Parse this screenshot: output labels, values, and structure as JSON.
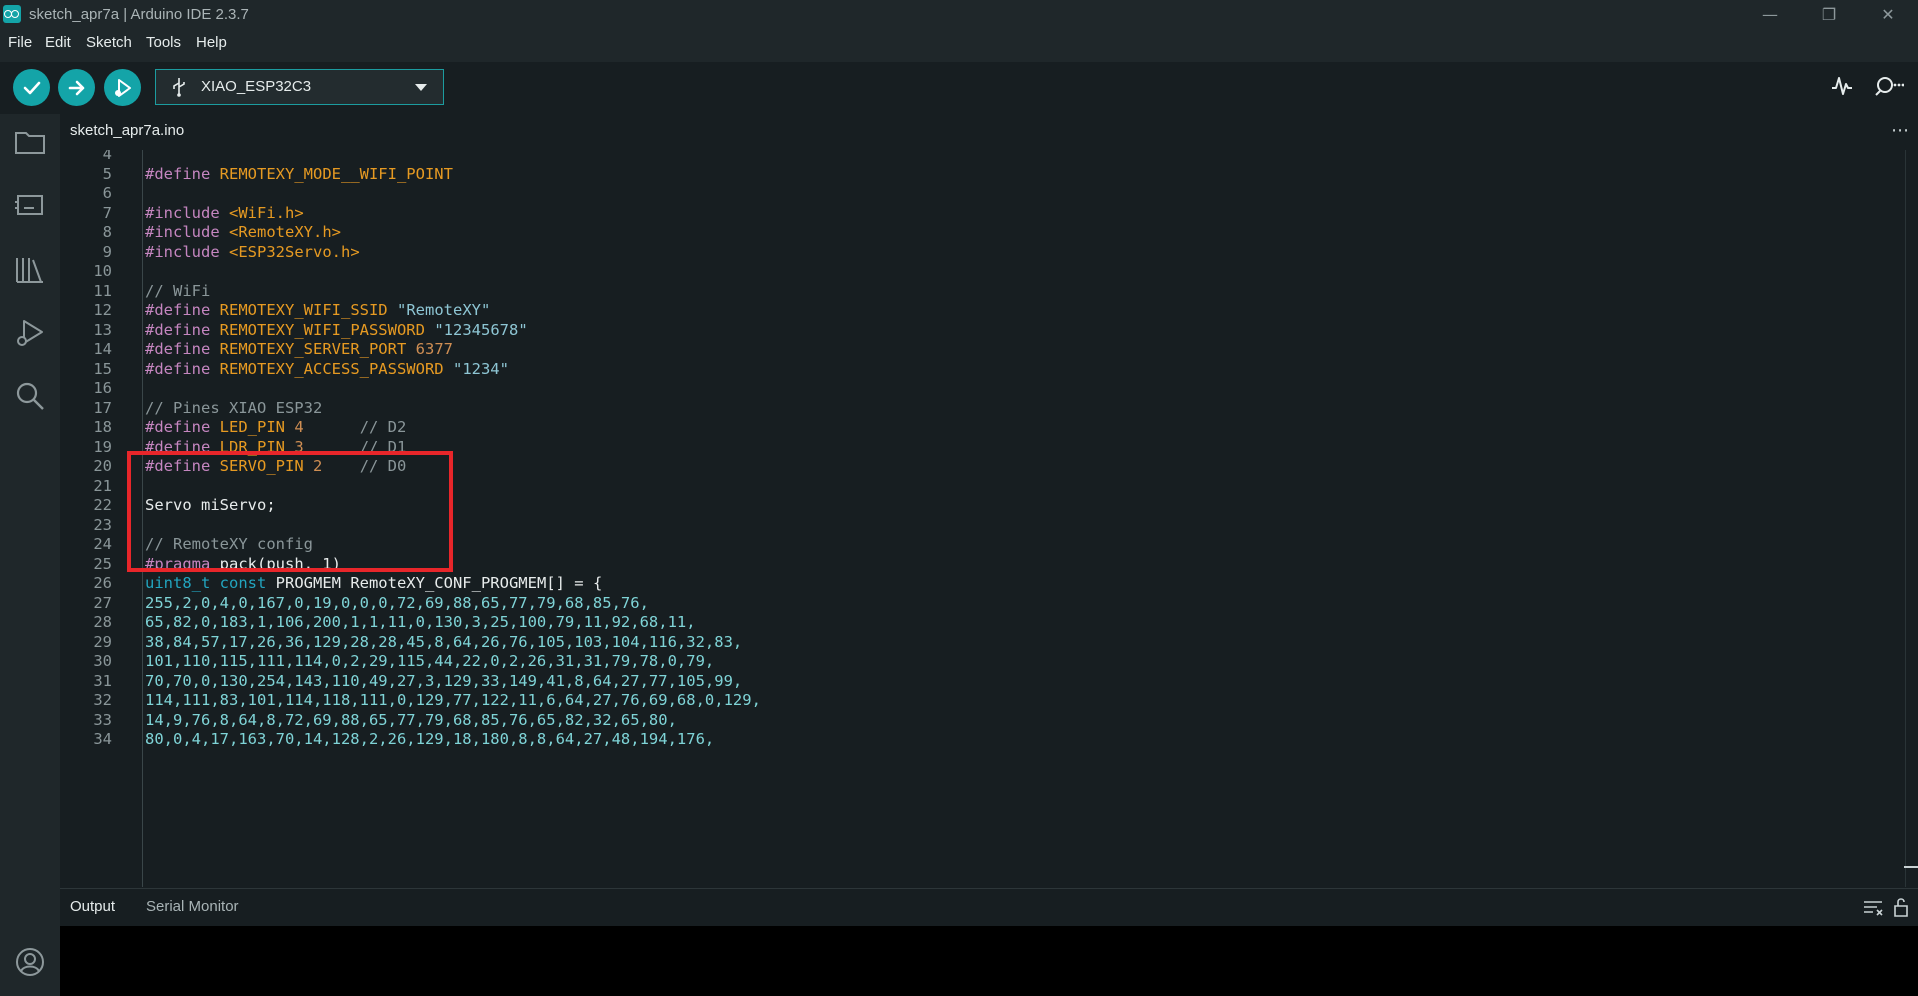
{
  "window": {
    "title": "sketch_apr7a | Arduino IDE 2.3.7"
  },
  "menu": [
    "File",
    "Edit",
    "Sketch",
    "Tools",
    "Help"
  ],
  "toolbar": {
    "board": "XIAO_ESP32C3"
  },
  "tabs": {
    "file": "sketch_apr7a.ino"
  },
  "editor": {
    "lines": [
      {
        "n": "4",
        "text": ""
      },
      {
        "n": "5",
        "text": "#define REMOTEXY_MODE__WIFI_POINT"
      },
      {
        "n": "6",
        "text": ""
      },
      {
        "n": "7",
        "text": "#include <WiFi.h>"
      },
      {
        "n": "8",
        "text": "#include <RemoteXY.h>"
      },
      {
        "n": "9",
        "text": "#include <ESP32Servo.h>"
      },
      {
        "n": "10",
        "text": ""
      },
      {
        "n": "11",
        "text": "// WiFi"
      },
      {
        "n": "12",
        "text": "#define REMOTEXY_WIFI_SSID \"RemoteXY\""
      },
      {
        "n": "13",
        "text": "#define REMOTEXY_WIFI_PASSWORD \"12345678\""
      },
      {
        "n": "14",
        "text": "#define REMOTEXY_SERVER_PORT 6377"
      },
      {
        "n": "15",
        "text": "#define REMOTEXY_ACCESS_PASSWORD \"1234\""
      },
      {
        "n": "16",
        "text": ""
      },
      {
        "n": "17",
        "text": "// Pines XIAO ESP32"
      },
      {
        "n": "18",
        "text": "#define LED_PIN 4      // D2"
      },
      {
        "n": "19",
        "text": "#define LDR_PIN 3      // D1"
      },
      {
        "n": "20",
        "text": "#define SERVO_PIN 2    // D0"
      },
      {
        "n": "21",
        "text": ""
      },
      {
        "n": "22",
        "text": "Servo miServo;"
      },
      {
        "n": "23",
        "text": ""
      },
      {
        "n": "24",
        "text": "// RemoteXY config"
      },
      {
        "n": "25",
        "text": "#pragma pack(push, 1)"
      },
      {
        "n": "26",
        "text": "uint8_t const PROGMEM RemoteXY_CONF_PROGMEM[] = {"
      },
      {
        "n": "27",
        "text": "255,2,0,4,0,167,0,19,0,0,0,72,69,88,65,77,79,68,85,76,"
      },
      {
        "n": "28",
        "text": "65,82,0,183,1,106,200,1,1,11,0,130,3,25,100,79,11,92,68,11,"
      },
      {
        "n": "29",
        "text": "38,84,57,17,26,36,129,28,28,45,8,64,26,76,105,103,104,116,32,83,"
      },
      {
        "n": "30",
        "text": "101,110,115,111,114,0,2,29,115,44,22,0,2,26,31,31,79,78,0,79,"
      },
      {
        "n": "31",
        "text": "70,70,0,130,254,143,110,49,27,3,129,33,149,41,8,64,27,77,105,99,"
      },
      {
        "n": "32",
        "text": "114,111,83,101,114,118,111,0,129,77,122,11,6,64,27,76,69,68,0,129,"
      },
      {
        "n": "33",
        "text": "14,9,76,8,64,8,72,69,88,65,77,79,68,85,76,65,82,32,65,80,"
      },
      {
        "n": "34",
        "text": "80,0,4,17,163,70,14,128,2,26,129,18,180,8,8,64,27,48,194,176,"
      }
    ]
  },
  "panel": {
    "output_tab": "Output",
    "serial_tab": "Serial Monitor"
  }
}
